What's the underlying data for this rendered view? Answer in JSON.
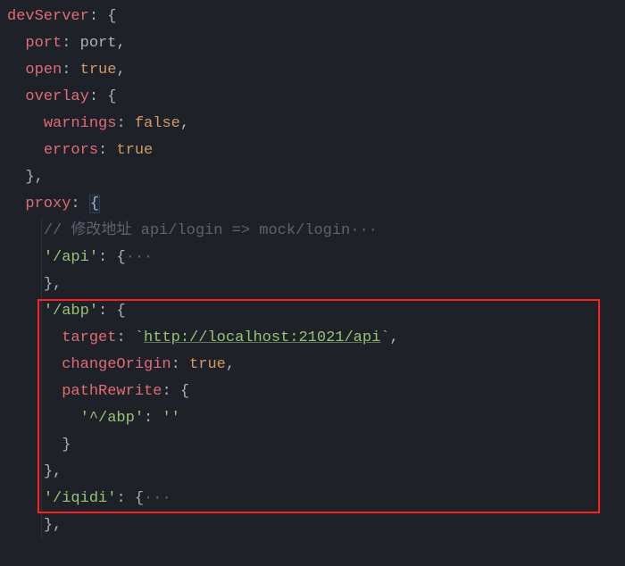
{
  "lines": {
    "l1_key": "devServer",
    "l2_key": "port",
    "l2_val": "port",
    "l3_key": "open",
    "l3_val": "true",
    "l4_key": "overlay",
    "l5_key": "warnings",
    "l5_val": "false",
    "l6_key": "errors",
    "l6_val": "true",
    "l8_key": "proxy",
    "l9_comment": "// 修改地址 api/login => mock/login",
    "l10_key": "'/api'",
    "l12_key": "'/abp'",
    "l13_key": "target",
    "l13_val": "http://localhost:21021/api",
    "l14_key": "changeOrigin",
    "l14_val": "true",
    "l15_key": "pathRewrite",
    "l16_key": "'^/abp'",
    "l16_val": "''",
    "l19_key": "'/iqidi'",
    "fold": "···"
  }
}
